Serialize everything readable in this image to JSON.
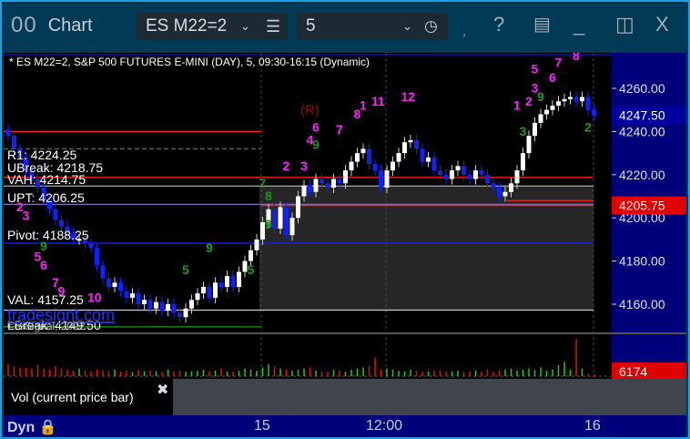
{
  "window": {
    "logo": "00",
    "title": "Chart",
    "symbol": "ES M22=2",
    "interval": "5",
    "buttons": {
      "help": "?",
      "minimize": "_",
      "close": "X"
    }
  },
  "chart": {
    "header": "* ES M22=2, S&P 500 FUTURES E-MINI (DAY), 5, 09:30-16:15 (Dynamic)",
    "price_axis": {
      "ticks": [
        "4260.00",
        "4240.00",
        "4220.00",
        "4200.00",
        "4180.00",
        "4160.00"
      ],
      "tick_values": [
        4260,
        4240,
        4220,
        4200,
        4180,
        4160
      ],
      "last_price": "4247.50",
      "level_label": "4205.75",
      "last_color": "#0000a0",
      "level_color": "#e00000"
    },
    "levels": [
      {
        "label": "R1: 4224.25",
        "value": 4232,
        "color": "#1a9a1a",
        "dash": true,
        "span": "left"
      },
      {
        "label": "UBreak: 4218.75",
        "value": 4218.75,
        "color": "#ff2020",
        "span": "full"
      },
      {
        "label": "VAH: 4214.75",
        "value": 4214.75,
        "color": "#aaaaaa",
        "span": "full"
      },
      {
        "label": "UPT: 4206.25",
        "value": 4206.25,
        "color": "#8a6fb0",
        "span": "full"
      },
      {
        "label": "Pivot: 4188.25",
        "value": 4188.25,
        "color": "#1020ff",
        "span": "full"
      },
      {
        "label": "VAL: 4157.25",
        "value": 4157.25,
        "color": "#cccccc",
        "span": "full"
      },
      {
        "label": "LBreak: 4149.50",
        "value": 4149.5,
        "color": "#1a9a1a",
        "span": "left"
      }
    ],
    "extra_lines": [
      {
        "value": 4240,
        "color": "#ff2020"
      },
      {
        "value": 4205.75,
        "color": "#ff2020"
      }
    ],
    "watermark_link": "tradesignt.com",
    "copyright": "© eSignal, 2022",
    "marker": "(R)",
    "closes": [
      4238,
      4232,
      4228,
      4222,
      4218,
      4214,
      4208,
      4204,
      4199,
      4196,
      4193,
      4190,
      4190,
      4188,
      4186,
      4178,
      4172,
      4168,
      4170,
      4166,
      4163,
      4165,
      4160,
      4162,
      4158,
      4161,
      4157,
      4160,
      4156,
      4154,
      4158,
      4162,
      4165,
      4168,
      4163,
      4170,
      4168,
      4173,
      4168,
      4175,
      4180,
      4185,
      4190,
      4198,
      4204,
      4195,
      4205,
      4192,
      4200,
      4210,
      4215,
      4212,
      4218,
      4216,
      4214,
      4218,
      4216,
      4222,
      4226,
      4230,
      4232,
      4225,
      4222,
      4214,
      4222,
      4226,
      4230,
      4235,
      4236,
      4232,
      4226,
      4228,
      4222,
      4220,
      4218,
      4222,
      4224,
      4220,
      4218,
      4222,
      4220,
      4216,
      4214,
      4210,
      4212,
      4216,
      4222,
      4230,
      4238,
      4244,
      4248,
      4250,
      4252,
      4254,
      4255,
      4256,
      4254,
      4256,
      4250,
      4247.5
    ],
    "counts": [
      {
        "t": "2",
        "c": "#ff20ff",
        "bar": 2,
        "p": 4203
      },
      {
        "t": "3",
        "c": "#ff20ff",
        "bar": 3,
        "p": 4199
      },
      {
        "t": "9",
        "c": "#1a9a1a",
        "bar": 6,
        "p": 4185
      },
      {
        "t": "5",
        "c": "#ff20ff",
        "bar": 5,
        "p": 4180
      },
      {
        "t": "6",
        "c": "#ff20ff",
        "bar": 6,
        "p": 4176
      },
      {
        "t": "7",
        "c": "#ff20ff",
        "bar": 8,
        "p": 4168
      },
      {
        "t": "9",
        "c": "#ff20ff",
        "bar": 9,
        "p": 4164
      },
      {
        "t": "10",
        "c": "#ff20ff",
        "bar": 14,
        "p": 4161
      },
      {
        "t": "5",
        "c": "#1a9a1a",
        "bar": 30,
        "p": 4174
      },
      {
        "t": "9",
        "c": "#1a9a1a",
        "bar": 34,
        "p": 4184
      },
      {
        "t": "5",
        "c": "#1a9a1a",
        "bar": 41,
        "p": 4174
      },
      {
        "t": "9",
        "c": "#1a9a1a",
        "bar": 44,
        "p": 4195
      },
      {
        "t": "7",
        "c": "#1a9a1a",
        "bar": 43,
        "p": 4214
      },
      {
        "t": "8",
        "c": "#1a9a1a",
        "bar": 44,
        "p": 4208
      },
      {
        "t": "2",
        "c": "#ff20ff",
        "bar": 47,
        "p": 4222
      },
      {
        "t": "3",
        "c": "#ff20ff",
        "bar": 50,
        "p": 4222
      },
      {
        "t": "4",
        "c": "#ff20ff",
        "bar": 51,
        "p": 4234
      },
      {
        "t": "6",
        "c": "#ff20ff",
        "bar": 52,
        "p": 4240
      },
      {
        "t": "9",
        "c": "#1a9a1a",
        "bar": 52,
        "p": 4232
      },
      {
        "t": "7",
        "c": "#ff20ff",
        "bar": 56,
        "p": 4239
      },
      {
        "t": "8",
        "c": "#ff20ff",
        "bar": 59,
        "p": 4246
      },
      {
        "t": "1",
        "c": "#ff20ff",
        "bar": 60,
        "p": 4250
      },
      {
        "t": "11",
        "c": "#ff20ff",
        "bar": 62,
        "p": 4252
      },
      {
        "t": "12",
        "c": "#ff20ff",
        "bar": 67,
        "p": 4254
      },
      {
        "t": "1",
        "c": "#ff20ff",
        "bar": 86,
        "p": 4250
      },
      {
        "t": "2",
        "c": "#ff20ff",
        "bar": 88,
        "p": 4252
      },
      {
        "t": "3",
        "c": "#1a9a1a",
        "bar": 87,
        "p": 4238
      },
      {
        "t": "9",
        "c": "#1a9a1a",
        "bar": 90,
        "p": 4254
      },
      {
        "t": "3",
        "c": "#ff20ff",
        "bar": 89,
        "p": 4258
      },
      {
        "t": "5",
        "c": "#ff20ff",
        "bar": 89,
        "p": 4267
      },
      {
        "t": "6",
        "c": "#ff20ff",
        "bar": 92,
        "p": 4263
      },
      {
        "t": "7",
        "c": "#ff20ff",
        "bar": 93,
        "p": 4270
      },
      {
        "t": "8",
        "c": "#ff20ff",
        "bar": 96,
        "p": 4273
      },
      {
        "t": "2",
        "c": "#1a9a1a",
        "bar": 98,
        "p": 4240
      }
    ],
    "volume": {
      "last": "6174",
      "last_color": "#e00000",
      "label": "Vol (current price bar)",
      "values": [
        22,
        18,
        16,
        15,
        14,
        20,
        14,
        12,
        18,
        14,
        12,
        10,
        14,
        10,
        9,
        12,
        11,
        10,
        12,
        9,
        10,
        8,
        11,
        9,
        10,
        9,
        8,
        12,
        9,
        10,
        8,
        9,
        10,
        12,
        9,
        10,
        14,
        9,
        8,
        10,
        14,
        12,
        10,
        16,
        22,
        18,
        14,
        12,
        10,
        12,
        14,
        16,
        10,
        9,
        8,
        12,
        10,
        8,
        12,
        14,
        16,
        18,
        34,
        12,
        14,
        12,
        10,
        9,
        12,
        10,
        8,
        9,
        10,
        11,
        8,
        9,
        10,
        8,
        9,
        10,
        8,
        12,
        9,
        10,
        12,
        14,
        10,
        12,
        14,
        11,
        16,
        10,
        12,
        20,
        26,
        12,
        68,
        14,
        4,
        3
      ],
      "up": "#30c020",
      "down": "#e01010"
    }
  },
  "xaxis": {
    "labels": [
      "15",
      "12:00",
      "16"
    ],
    "left": "Dyn"
  }
}
